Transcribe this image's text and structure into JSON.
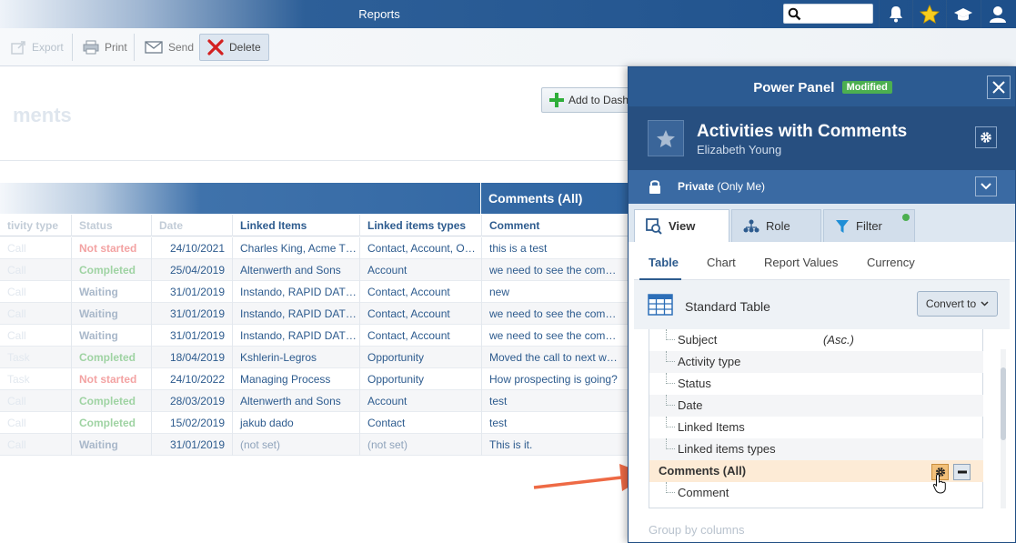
{
  "topbar": {
    "title": "Reports",
    "search_placeholder": ""
  },
  "toolbar": {
    "export": "Export",
    "print": "Print",
    "send": "Send",
    "delete": "Delete"
  },
  "page": {
    "title": "ments",
    "add_dashboard": "Add to Dash"
  },
  "table": {
    "group_header": "Comments (All)",
    "columns": [
      "tivity type",
      "Status",
      "Date",
      "Linked Items",
      "Linked items types",
      "Comment"
    ],
    "rows": [
      {
        "activity": "Call",
        "status": "Not started",
        "status_class": "not",
        "date": "24/10/2021",
        "linked": "Charles King, Acme T…",
        "types": "Contact, Account, O…",
        "comment": "this is a test"
      },
      {
        "activity": "Call",
        "status": "Completed",
        "status_class": "completed",
        "date": "25/04/2019",
        "linked": "Altenwerth and Sons",
        "types": "Account",
        "comment": "we need to see the com…"
      },
      {
        "activity": "Call",
        "status": "Waiting",
        "status_class": "waiting",
        "date": "31/01/2019",
        "linked": "Instando, RAPID DAT…",
        "types": "Contact, Account",
        "comment": "new"
      },
      {
        "activity": "Call",
        "status": "Waiting",
        "status_class": "waiting",
        "date": "31/01/2019",
        "linked": "Instando, RAPID DAT…",
        "types": "Contact, Account",
        "comment": "we need to see the com…"
      },
      {
        "activity": "Call",
        "status": "Waiting",
        "status_class": "waiting",
        "date": "31/01/2019",
        "linked": "Instando, RAPID DAT…",
        "types": "Contact, Account",
        "comment": "we need to see the com…"
      },
      {
        "activity": "Task",
        "status": "Completed",
        "status_class": "completed",
        "date": "18/04/2019",
        "linked": "Kshlerin-Legros",
        "types": "Opportunity",
        "comment": "Moved the call to next w…"
      },
      {
        "activity": "Task",
        "status": "Not started",
        "status_class": "not",
        "date": "24/10/2022",
        "linked": "Managing Process",
        "types": "Opportunity",
        "comment": "How prospecting is going?"
      },
      {
        "activity": "Call",
        "status": "Completed",
        "status_class": "completed",
        "date": "28/03/2019",
        "linked": "Altenwerth and Sons",
        "types": "Account",
        "comment": "test"
      },
      {
        "activity": "Call",
        "status": "Completed",
        "status_class": "completed",
        "date": "15/02/2019",
        "linked": "jakub dado",
        "types": "Contact",
        "comment": "test"
      },
      {
        "activity": "Call",
        "status": "Waiting",
        "status_class": "waiting",
        "date": "31/01/2019",
        "linked": "(not set)",
        "types": "(not set)",
        "comment": "This is it."
      }
    ]
  },
  "power_panel": {
    "title": "Power Panel",
    "badge": "Modified",
    "report_name": "Activities with Comments",
    "owner": "Elizabeth Young",
    "privacy_bold": "Private",
    "privacy_rest": " (Only Me)",
    "tabs": [
      "View",
      "Role",
      "Filter"
    ],
    "subtabs": [
      "Table",
      "Chart",
      "Report Values",
      "Currency"
    ],
    "table_type": "Standard Table",
    "convert_label": "Convert to",
    "tree": [
      {
        "name": "Subject",
        "sort": "(Asc.)"
      },
      {
        "name": "Activity type",
        "sort": ""
      },
      {
        "name": "Status",
        "sort": ""
      },
      {
        "name": "Date",
        "sort": ""
      },
      {
        "name": "Linked Items",
        "sort": ""
      },
      {
        "name": "Linked items types",
        "sort": ""
      }
    ],
    "selected_group": "Comments (All)",
    "child_item": "Comment",
    "group_by_label": "Group by columns"
  },
  "colors": {
    "accent": "#2d5b8e",
    "panel": "#2c5b92",
    "modified_badge": "#4caf50",
    "arrow": "#ee6a45",
    "selected_row": "#fdebd6"
  },
  "icons": [
    "search-icon",
    "bell-icon",
    "star-icon",
    "graduation-cap-icon",
    "user-icon",
    "export-icon",
    "print-icon",
    "send-icon",
    "delete-icon",
    "plus-icon",
    "close-icon",
    "star-icon",
    "gear-icon",
    "lock-icon",
    "chevron-down-icon",
    "eye-icon",
    "role-icon",
    "filter-icon",
    "table-icon",
    "minus-icon",
    "cursor-icon"
  ]
}
